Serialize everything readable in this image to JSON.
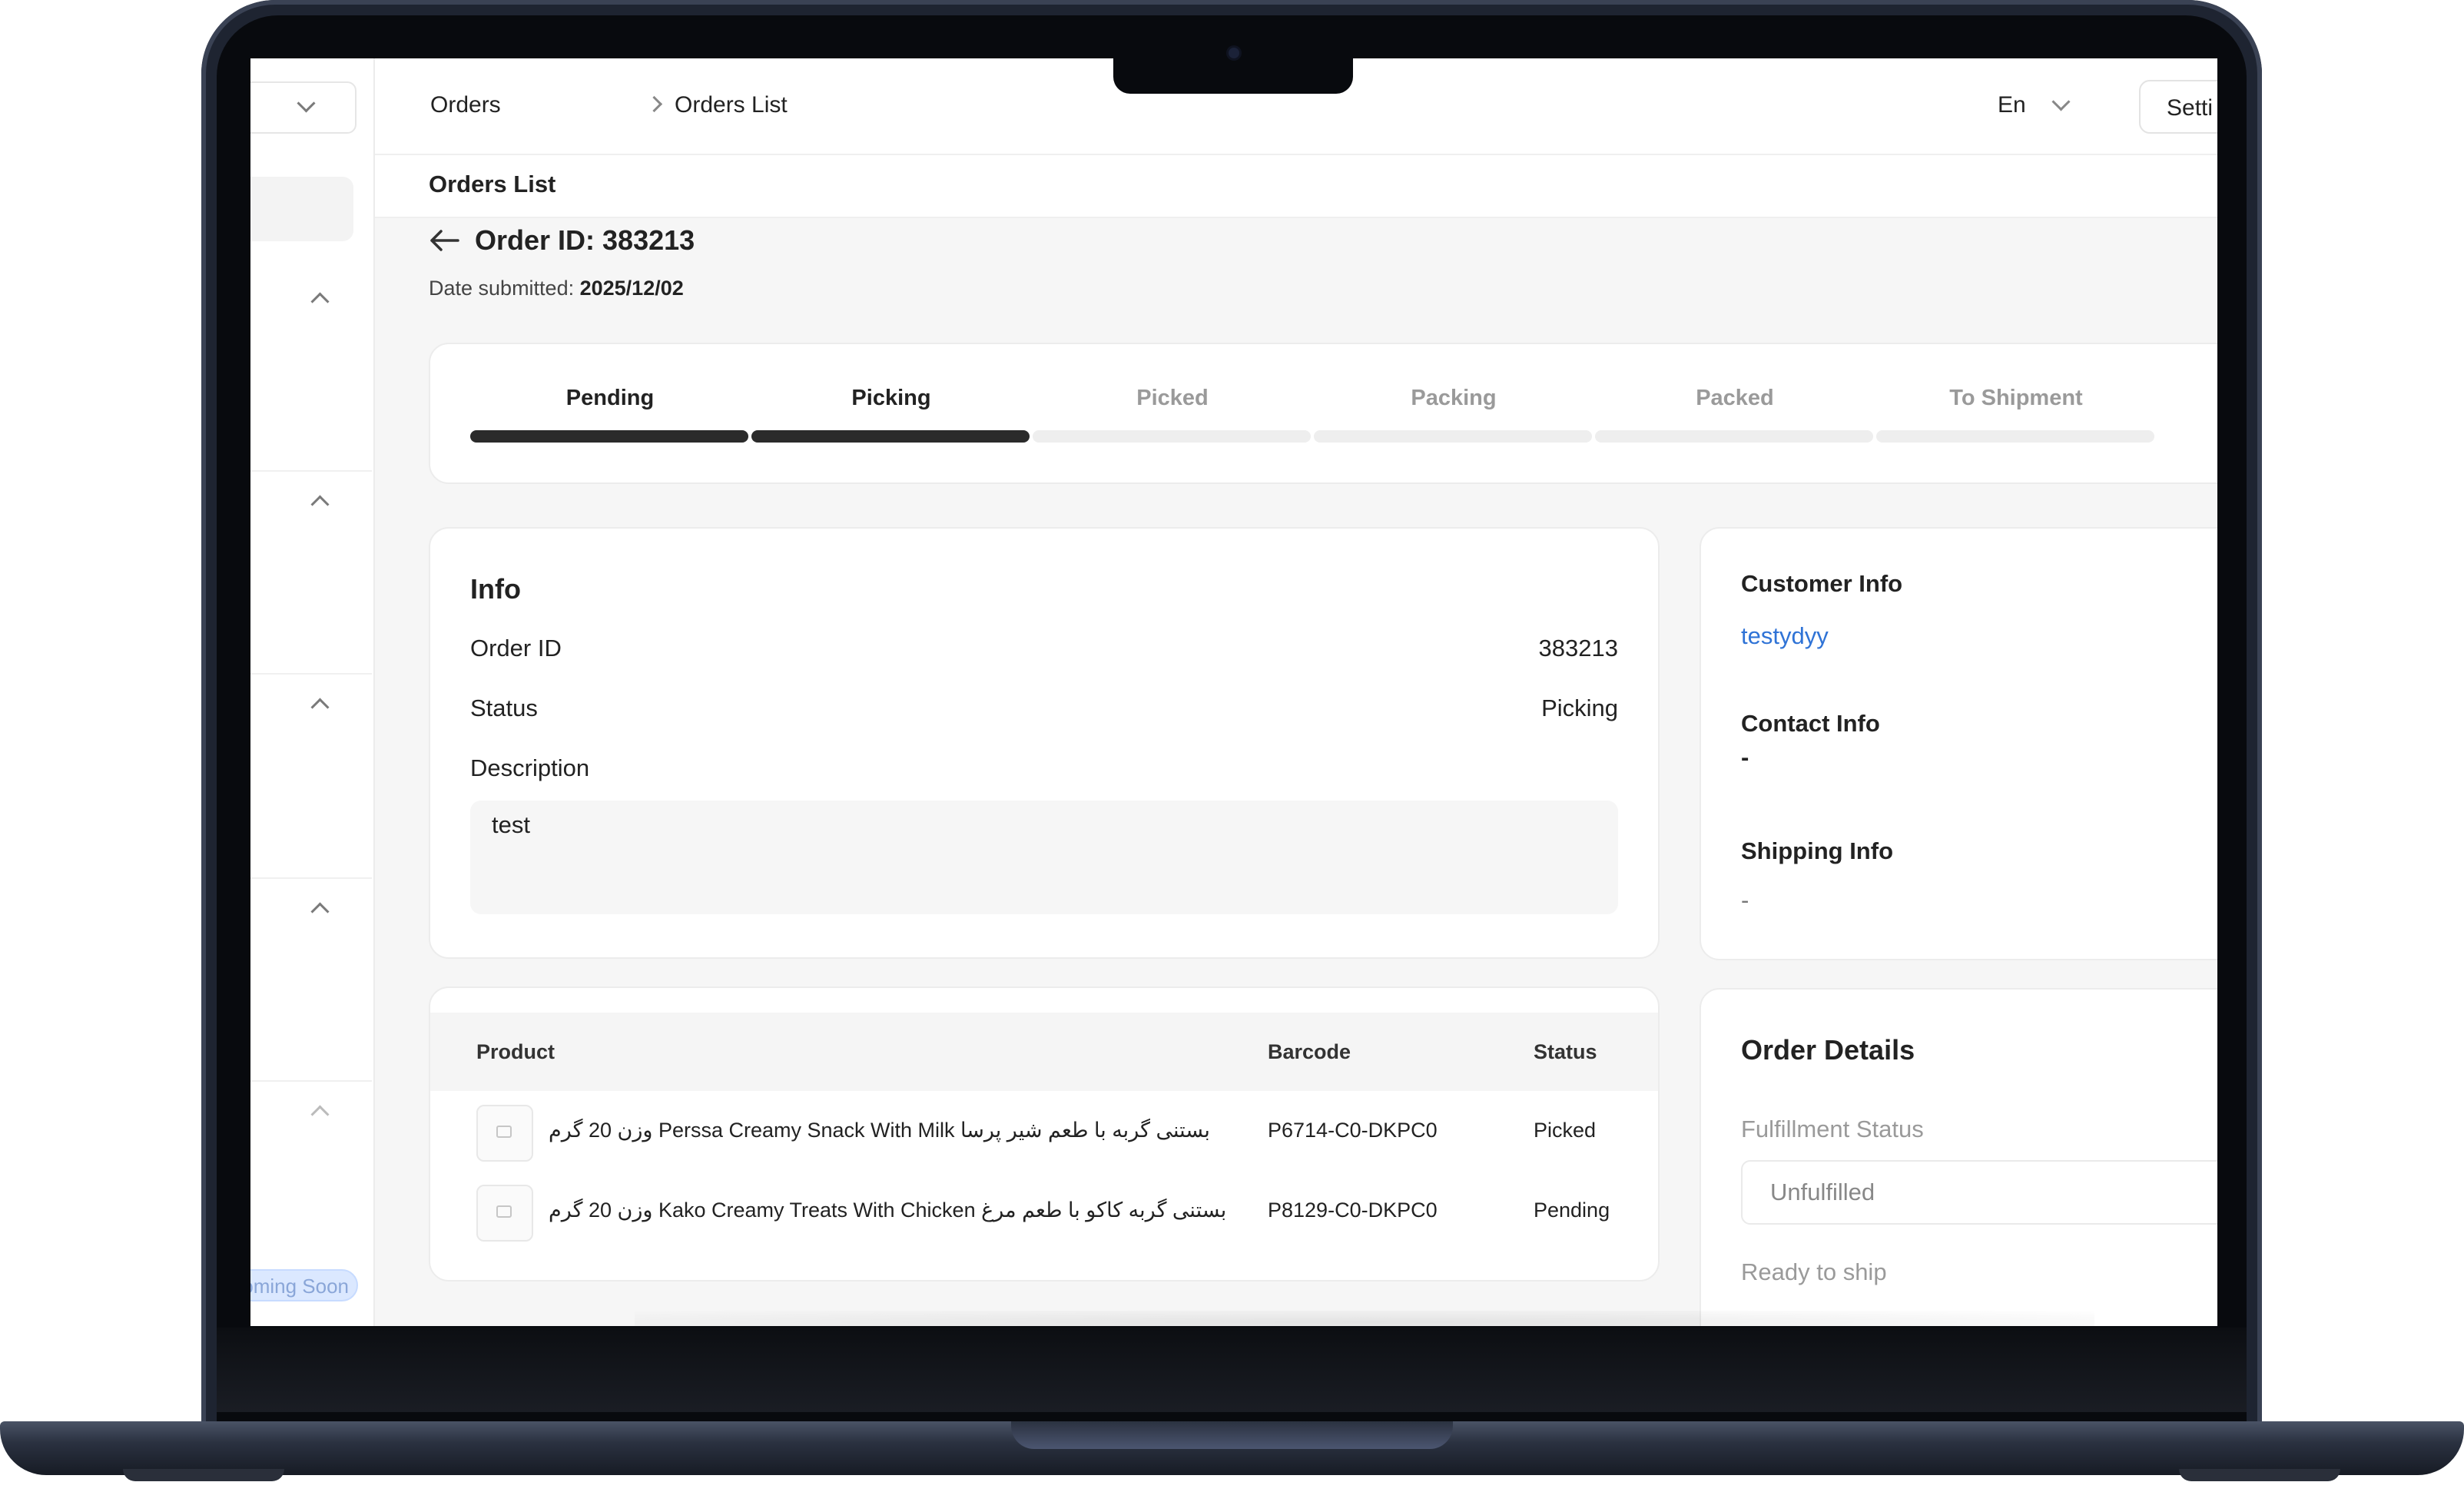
{
  "breadcrumb": {
    "root": "Orders",
    "current": "Orders List"
  },
  "language": {
    "selected": "En"
  },
  "settings_label": "Setti",
  "page_title": "Orders List",
  "order": {
    "title": "Order ID: 383213",
    "date_label": "Date submitted:",
    "date_value": "2025/12/02"
  },
  "steps": [
    {
      "label": "Pending",
      "state": "done"
    },
    {
      "label": "Picking",
      "state": "done"
    },
    {
      "label": "Picked",
      "state": "todo"
    },
    {
      "label": "Packing",
      "state": "todo"
    },
    {
      "label": "Packed",
      "state": "todo"
    },
    {
      "label": "To Shipment",
      "state": "todo"
    }
  ],
  "info": {
    "title": "Info",
    "order_id_label": "Order ID",
    "order_id_value": "383213",
    "status_label": "Status",
    "status_value": "Picking",
    "description_label": "Description",
    "description_value": "test"
  },
  "products_table": {
    "headers": {
      "product": "Product",
      "barcode": "Barcode",
      "status": "Status"
    },
    "rows": [
      {
        "product": "وزن 20 گرم Perssa Creamy Snack With Milk بستنی گربه با طعم شیر پرسا",
        "barcode": "P6714-C0-DKPC0",
        "status": "Picked"
      },
      {
        "product": "وزن 20 گرم Kako Creamy Treats With Chicken بستنی گربه کاکو با طعم مرغ",
        "barcode": "P8129-C0-DKPC0",
        "status": "Pending"
      }
    ]
  },
  "customer": {
    "customer_info_title": "Customer Info",
    "customer_name": "testydyy",
    "contact_info_title": "Contact Info",
    "contact_value": "-",
    "shipping_info_title": "Shipping Info",
    "shipping_value": "-"
  },
  "order_details": {
    "title": "Order Details",
    "fulfillment_label": "Fulfillment Status",
    "fulfillment_value": "Unfulfilled",
    "ready_label": "Ready to ship"
  },
  "sidebar": {
    "badge": "Coming Soon"
  },
  "colors": {
    "step_done": "#2b2b2b",
    "step_todo": "#eeeeee",
    "link": "#2f73d6",
    "badge_bg": "#dbe8ff"
  }
}
